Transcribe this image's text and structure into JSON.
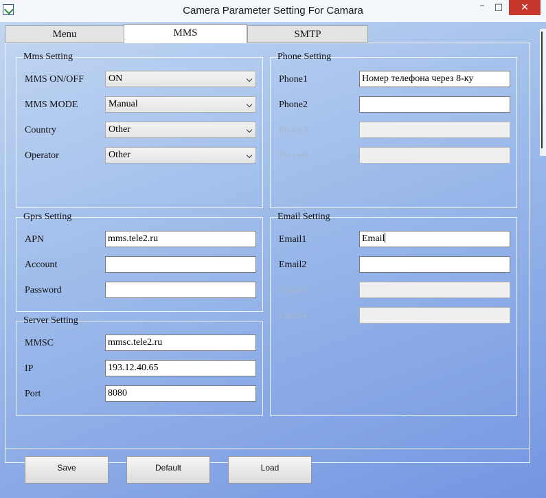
{
  "window": {
    "title": "Camera Parameter Setting For  Camara",
    "min_glyph": "–",
    "max_glyph": "□",
    "close_glyph": "✕"
  },
  "tabs": [
    {
      "label": "Menu",
      "active": false
    },
    {
      "label": "MMS",
      "active": true
    },
    {
      "label": "SMTP",
      "active": false
    }
  ],
  "mms_setting": {
    "title": "Mms Setting",
    "rows": [
      {
        "label": "MMS ON/OFF",
        "value": "ON"
      },
      {
        "label": "MMS MODE",
        "value": "Manual"
      },
      {
        "label": "Country",
        "value": "Other"
      },
      {
        "label": "Operator",
        "value": "Other"
      }
    ]
  },
  "phone_setting": {
    "title": "Phone Setting",
    "rows": [
      {
        "label": "Phone1",
        "value": "Номер телефона через 8-ку",
        "enabled": true
      },
      {
        "label": "Phone2",
        "value": "",
        "enabled": true
      },
      {
        "label": "Phone3",
        "value": "",
        "enabled": false
      },
      {
        "label": "Phone4",
        "value": "",
        "enabled": false
      }
    ]
  },
  "gprs_setting": {
    "title": "Gprs Setting",
    "rows": [
      {
        "label": "APN",
        "value": "mms.tele2.ru"
      },
      {
        "label": "Account",
        "value": ""
      },
      {
        "label": "Password",
        "value": ""
      }
    ]
  },
  "server_setting": {
    "title": "Server Setting",
    "rows": [
      {
        "label": "MMSC",
        "value": "mmsc.tele2.ru"
      },
      {
        "label": "IP",
        "value": "193.12.40.65"
      },
      {
        "label": "Port",
        "value": "8080"
      }
    ]
  },
  "email_setting": {
    "title": "Email Setting",
    "rows": [
      {
        "label": "Email1",
        "value": "Email",
        "enabled": true
      },
      {
        "label": "Email2",
        "value": "",
        "enabled": true
      },
      {
        "label": "Email3",
        "value": "",
        "enabled": false
      },
      {
        "label": "Email4",
        "value": "",
        "enabled": false
      }
    ]
  },
  "buttons": {
    "save": "Save",
    "default": "Default",
    "load": "Load"
  }
}
